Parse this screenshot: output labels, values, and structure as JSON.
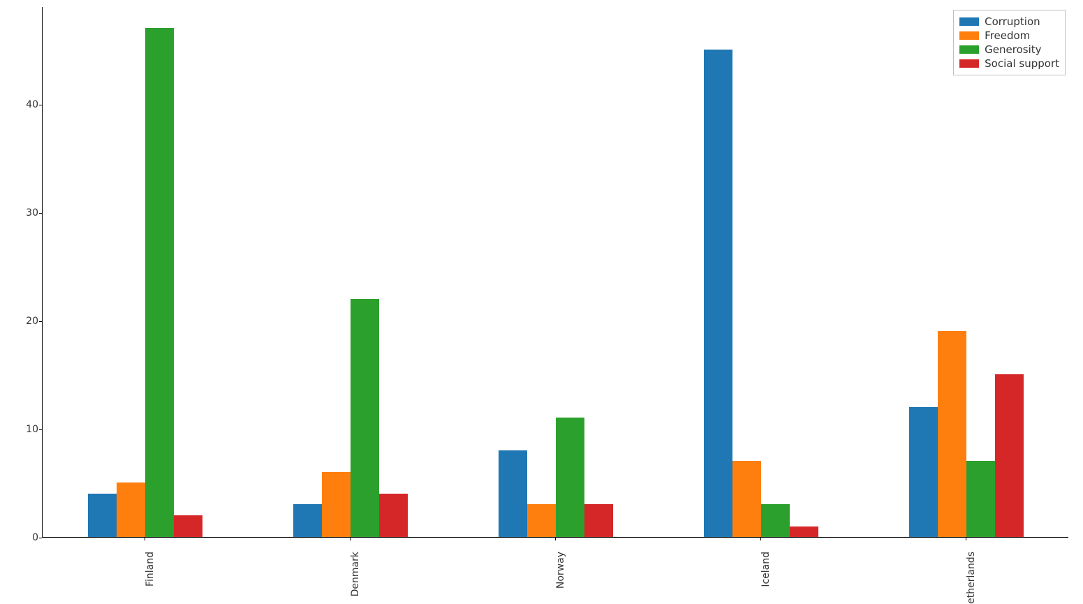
{
  "chart_data": {
    "type": "bar",
    "categories": [
      "Finland",
      "Denmark",
      "Norway",
      "Iceland",
      "Netherlands"
    ],
    "xtick_labels": [
      "Finland",
      "Denmark",
      "Norway",
      "Iceland",
      "etherlands"
    ],
    "series": [
      {
        "name": "Corruption",
        "color": "#1f77b4",
        "values": [
          4,
          3,
          8,
          45,
          12
        ]
      },
      {
        "name": "Freedom",
        "color": "#ff7f0e",
        "values": [
          5,
          6,
          3,
          7,
          19
        ]
      },
      {
        "name": "Generosity",
        "color": "#2ca02c",
        "values": [
          47,
          22,
          11,
          3,
          7
        ]
      },
      {
        "name": "Social support",
        "color": "#d62728",
        "values": [
          2,
          4,
          3,
          1,
          15
        ]
      }
    ],
    "yticks": [
      0,
      10,
      20,
      30,
      40
    ],
    "ylim": [
      0,
      49
    ],
    "title": "",
    "xlabel": "",
    "ylabel": "",
    "legend_position": "upper right"
  }
}
